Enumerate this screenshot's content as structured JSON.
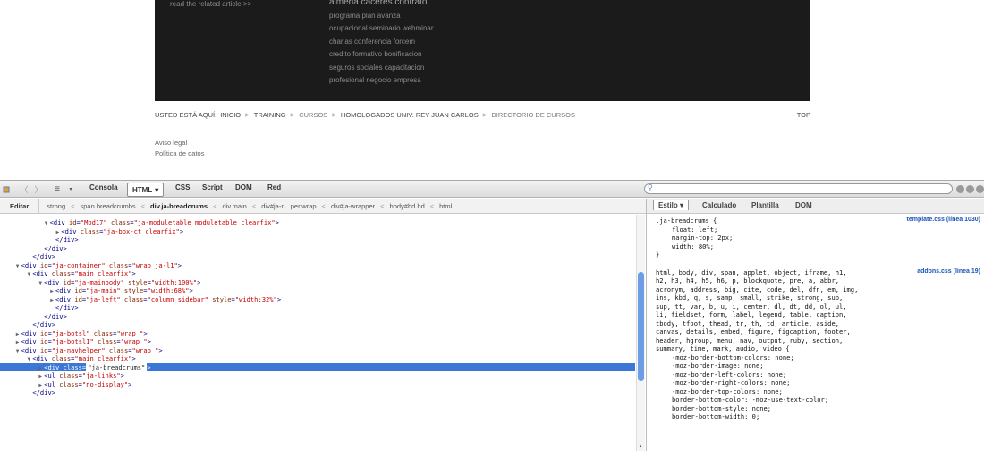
{
  "site": {
    "read_link": "read the related article >>",
    "tags": [
      "almeria  caceres  contrato",
      "programa  plan  avanza",
      "ocupacional  seminario  webminar",
      "charlas  conferencia  forcem",
      "credito  formativo  bonificacion",
      "seguros  sociales  capacitacion",
      "profesional  negocio  empresa"
    ],
    "breadcrumb": {
      "label": "USTED ESTÁ AQUÍ:",
      "items": [
        "INICIO",
        "TRAINING",
        "CURSOS",
        "HOMOLOGADOS UNIV. REY JUAN CARLOS",
        "DIRECTORIO DE CURSOS"
      ],
      "top": "TOP"
    },
    "footer": [
      "Aviso legal",
      "Política de datos"
    ]
  },
  "toolbar": {
    "tabs": [
      "Consola",
      "HTML",
      "CSS",
      "Script",
      "DOM",
      "Red"
    ],
    "selected_tab": "HTML",
    "dropdown_glyph": "▾"
  },
  "path": {
    "edit": "Editar",
    "segments": [
      "strong",
      "span.breadcrumbs",
      "div.ja-breadcrums",
      "div.main",
      "div#ja-n...per.wrap",
      "div#ja-wrapper",
      "body#bd.bd",
      "html"
    ],
    "separator": "<"
  },
  "side": {
    "tabs": [
      "Estilo",
      "Calculado",
      "Plantilla",
      "DOM"
    ]
  },
  "tree": [
    {
      "indent": 9,
      "tw": "▼",
      "tag": "div",
      "attrs": [
        [
          "id",
          "Mod17"
        ],
        [
          "class",
          "ja-moduletable moduletable clearfix"
        ]
      ]
    },
    {
      "indent": 11,
      "tw": "▶",
      "tag": "div",
      "attrs": [
        [
          "class",
          "ja-box-ct clearfix"
        ]
      ]
    },
    {
      "indent": 10,
      "tw": "",
      "close": "div"
    },
    {
      "indent": 8,
      "tw": "",
      "close": "div"
    },
    {
      "indent": 6,
      "tw": "",
      "close": "div"
    },
    {
      "indent": 4,
      "tw": "▼",
      "tag": "div",
      "attrs": [
        [
          "id",
          "ja-container"
        ],
        [
          "class",
          "wrap ja-l1"
        ]
      ]
    },
    {
      "indent": 6,
      "tw": "▼",
      "tag": "div",
      "attrs": [
        [
          "class",
          "main clearfix"
        ]
      ]
    },
    {
      "indent": 8,
      "tw": "▼",
      "tag": "div",
      "attrs": [
        [
          "id",
          "ja-mainbody"
        ],
        [
          "style",
          "width:100%"
        ]
      ]
    },
    {
      "indent": 10,
      "tw": "▶",
      "tag": "div",
      "attrs": [
        [
          "id",
          "ja-main"
        ],
        [
          "style",
          "width:68%"
        ]
      ]
    },
    {
      "indent": 10,
      "tw": "▶",
      "tag": "div",
      "attrs": [
        [
          "id",
          "ja-left"
        ],
        [
          "class",
          "column sidebar"
        ],
        [
          "style",
          "width:32%"
        ]
      ]
    },
    {
      "indent": 10,
      "tw": "",
      "close": "div"
    },
    {
      "indent": 8,
      "tw": "",
      "close": "div"
    },
    {
      "indent": 6,
      "tw": "",
      "close": "div"
    },
    {
      "indent": 4,
      "tw": "▶",
      "tag": "div",
      "attrs": [
        [
          "id",
          "ja-botsl"
        ],
        [
          "class",
          "wrap "
        ]
      ]
    },
    {
      "indent": 4,
      "tw": "▶",
      "tag": "div",
      "attrs": [
        [
          "id",
          "ja-botsl1"
        ],
        [
          "class",
          "wrap "
        ]
      ]
    },
    {
      "indent": 4,
      "tw": "▼",
      "tag": "div",
      "attrs": [
        [
          "id",
          "ja-navhelper"
        ],
        [
          "class",
          "wrap "
        ]
      ]
    },
    {
      "indent": 6,
      "tw": "▼",
      "tag": "div",
      "attrs": [
        [
          "class",
          "main clearfix"
        ]
      ]
    },
    {
      "indent": 8,
      "tw": "▶",
      "tag": "div",
      "attrs": [
        [
          "class",
          "ja-breadcrums"
        ]
      ],
      "selected": true
    },
    {
      "indent": 8,
      "tw": "▶",
      "tag": "ul",
      "attrs": [
        [
          "class",
          "ja-links"
        ]
      ]
    },
    {
      "indent": 8,
      "tw": "▶",
      "tag": "ul",
      "attrs": [
        [
          "class",
          "no-display"
        ]
      ]
    },
    {
      "indent": 6,
      "tw": "",
      "close": "div"
    }
  ],
  "rules": [
    {
      "src": "template.css (línea 1030)",
      "lines": [
        {
          "t": ".ja-breadcrums {",
          "ind": false
        },
        {
          "t": "float: left;",
          "ind": true
        },
        {
          "t": "margin-top: 2px;",
          "ind": true
        },
        {
          "t": "width: 80%;",
          "ind": true
        },
        {
          "t": "}",
          "ind": false
        }
      ]
    },
    {
      "src": "addons.css (línea 19)",
      "lines": [
        {
          "t": "html, body, div, span, applet, object, iframe, h1,",
          "ind": false
        },
        {
          "t": "h2, h3, h4, h5, h6, p, blockquote, pre, a, abbr,",
          "ind": false
        },
        {
          "t": "acronym, address, big, cite, code, del, dfn, em, img,",
          "ind": false
        },
        {
          "t": "ins, kbd, q, s, samp, small, strike, strong, sub,",
          "ind": false
        },
        {
          "t": "sup, tt, var, b, u, i, center, dl, dt, dd, ol, ul,",
          "ind": false
        },
        {
          "t": "li, fieldset, form, label, legend, table, caption,",
          "ind": false
        },
        {
          "t": "tbody, tfoot, thead, tr, th, td, article, aside,",
          "ind": false
        },
        {
          "t": "canvas, details, embed, figure, figcaption, footer,",
          "ind": false
        },
        {
          "t": "header, hgroup, menu, nav, output, ruby, section,",
          "ind": false
        },
        {
          "t": "summary, time, mark, audio, video {",
          "ind": false
        },
        {
          "t": "-moz-border-bottom-colors: none;",
          "ind": true
        },
        {
          "t": "-moz-border-image: none;",
          "ind": true
        },
        {
          "t": "-moz-border-left-colors: none;",
          "ind": true
        },
        {
          "t": "-moz-border-right-colors: none;",
          "ind": true
        },
        {
          "t": "-moz-border-top-colors: none;",
          "ind": true
        },
        {
          "t": "border-bottom-color: -moz-use-text-color;",
          "ind": true
        },
        {
          "t": "border-bottom-style: none;",
          "ind": true
        },
        {
          "t": "border-bottom-width: 0;",
          "ind": true
        }
      ]
    }
  ]
}
